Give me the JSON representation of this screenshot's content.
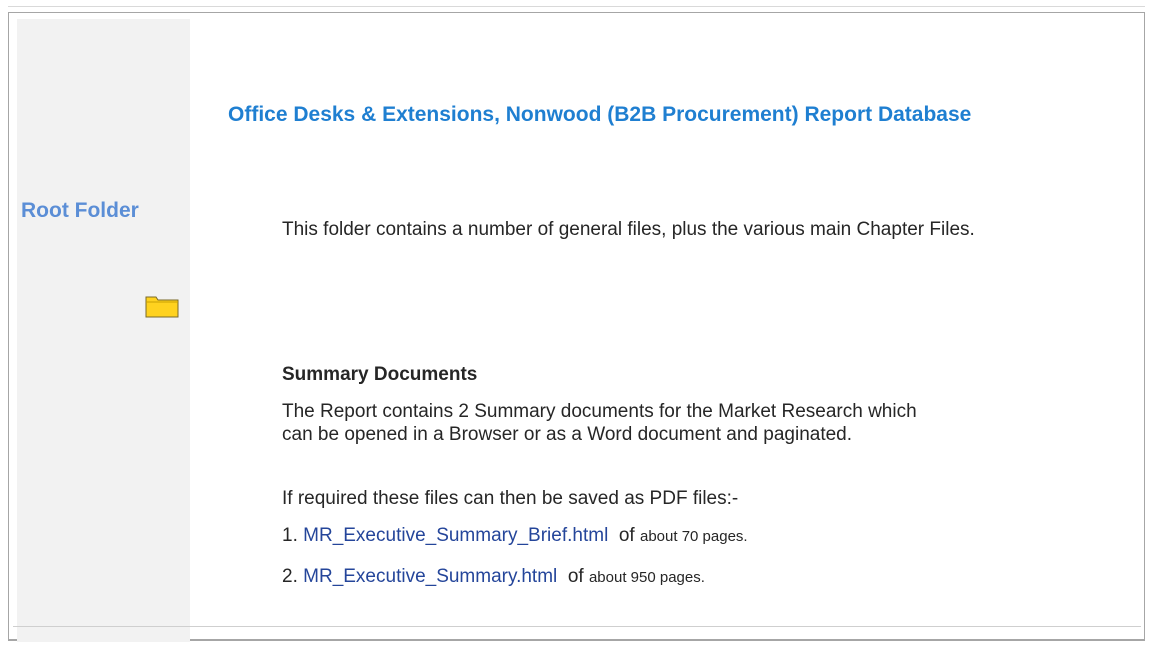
{
  "sidebar": {
    "label": "Root Folder",
    "icon": "folder-icon",
    "folder_color": "#ffd21f"
  },
  "main": {
    "title": "Office Desks & Extensions, Nonwood (B2B Procurement) Report Database",
    "intro": "This folder contains a number of general files, plus the various main Chapter Files.",
    "section_heading": "Summary Documents",
    "summary_text": "The Report contains 2 Summary documents for the Market Research which can be opened in a Browser or as a Word document and paginated.",
    "save_note": "If required these files can then be saved as PDF files:-",
    "documents": [
      {
        "number": "1.",
        "link": "MR_Executive_Summary_Brief.html",
        "of": "of",
        "about": "about 70 pages."
      },
      {
        "number": "2.",
        "link": "MR_Executive_Summary.html",
        "of": "of",
        "about": "about 950 pages."
      }
    ]
  },
  "colors": {
    "title": "#1f7fd1",
    "sidebar_label": "#5b8ed6",
    "link": "#24459a",
    "sidebar_bg": "#f2f2f2"
  }
}
